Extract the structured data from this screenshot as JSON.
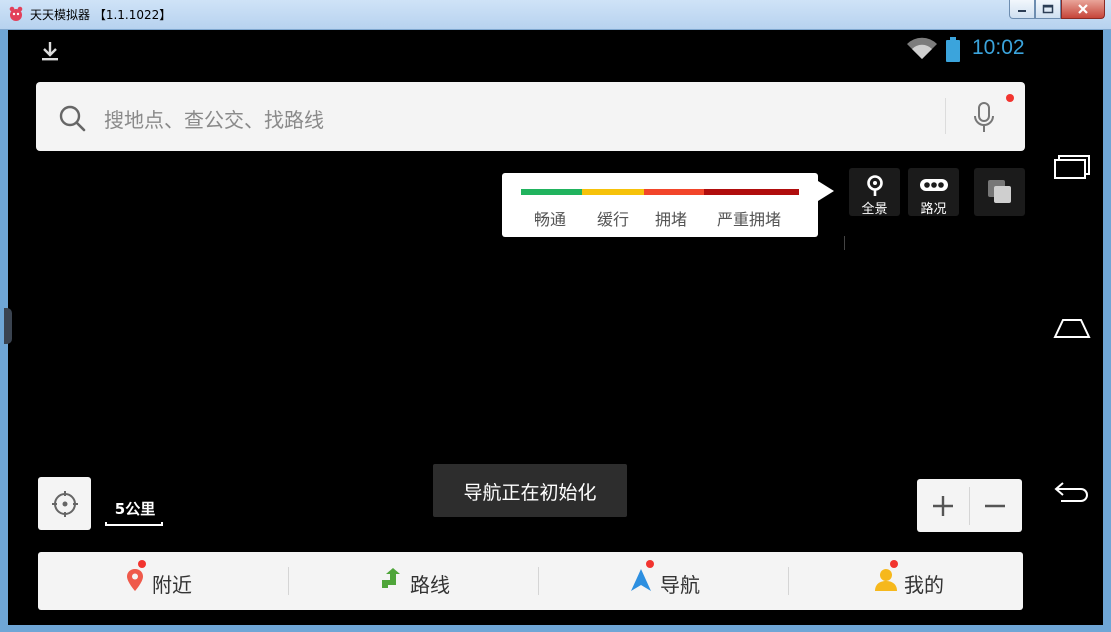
{
  "window": {
    "title": "天天模拟器 【1.1.1022】",
    "controls": [
      "minimize",
      "maximize",
      "close"
    ]
  },
  "status_bar": {
    "icons": [
      "download-icon",
      "wifi-icon",
      "battery-icon"
    ],
    "time": "10:02"
  },
  "search": {
    "placeholder": "搜地点、查公交、找路线",
    "has_notification_dot": true
  },
  "traffic_legend": {
    "items": [
      {
        "label": "畅通",
        "color": "#21b35e"
      },
      {
        "label": "缓行",
        "color": "#f6c20a"
      },
      {
        "label": "拥堵",
        "color": "#f2452a"
      },
      {
        "label": "严重拥堵",
        "color": "#b00d0d"
      }
    ]
  },
  "map_tools": [
    {
      "label": "全景",
      "icon": "panorama-pin-icon"
    },
    {
      "label": "路况",
      "icon": "traffic-icon"
    },
    {
      "label": "",
      "icon": "layers-icon"
    }
  ],
  "scale": {
    "label": "5公里"
  },
  "toast": {
    "text": "导航正在初始化"
  },
  "zoom": {
    "in": "+",
    "out": "−"
  },
  "bottom_tabs": [
    {
      "label": "附近",
      "icon": "nearby-pin-icon",
      "icon_color": "#ef5a4b",
      "dot": true
    },
    {
      "label": "路线",
      "icon": "route-arrow-icon",
      "icon_color": "#4fa53a",
      "dot": false
    },
    {
      "label": "导航",
      "icon": "navigation-arrow-icon",
      "icon_color": "#2d8fe0",
      "dot": true
    },
    {
      "label": "我的",
      "icon": "profile-icon",
      "icon_color": "#f6b81c",
      "dot": true
    }
  ],
  "android_nav": [
    "recent-apps-icon",
    "home-icon",
    "back-icon"
  ],
  "colors": {
    "accent": "#3ba4dc",
    "notification": "#f2342f"
  }
}
